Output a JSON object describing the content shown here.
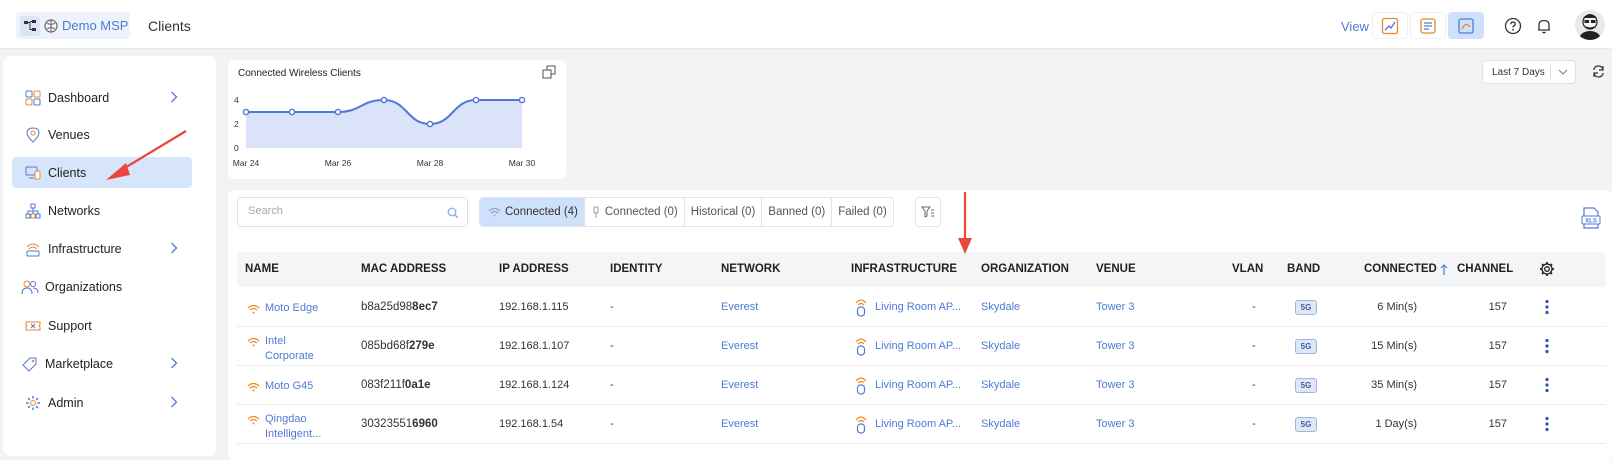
{
  "header": {
    "brand": "Demo MSP",
    "page_title": "Clients",
    "view_label": "View",
    "view_buttons": [
      "dashboard-view-icon",
      "report-view-icon",
      "analytics-view-icon"
    ],
    "active_view": 2
  },
  "sidebar": {
    "items": [
      {
        "label": "Dashboard",
        "icon": "dashboard-icon",
        "chevron": true
      },
      {
        "label": "Venues",
        "icon": "location-pin-icon",
        "chevron": false
      },
      {
        "label": "Clients",
        "icon": "devices-icon",
        "chevron": false,
        "active": true
      },
      {
        "label": "Networks",
        "icon": "network-icon",
        "chevron": false
      },
      {
        "label": "Infrastructure",
        "icon": "access-point-icon",
        "chevron": true
      },
      {
        "label": "Organizations",
        "icon": "users-icon",
        "chevron": false
      },
      {
        "label": "Support",
        "icon": "ticket-icon",
        "chevron": false
      },
      {
        "label": "Marketplace",
        "icon": "tag-icon",
        "chevron": true
      },
      {
        "label": "Admin",
        "icon": "gear-icon",
        "chevron": true
      }
    ]
  },
  "chart_card": {
    "title": "Connected Wireless Clients"
  },
  "chart_data": {
    "type": "area",
    "title": "Connected Wireless Clients",
    "x": [
      "Mar 24",
      "Mar 25",
      "Mar 26",
      "Mar 27",
      "Mar 28",
      "Mar 29",
      "Mar 30"
    ],
    "x_tick_labels": [
      "Mar 24",
      "Mar 26",
      "Mar 28",
      "Mar 30"
    ],
    "values": [
      3,
      3,
      3,
      4,
      2,
      4,
      4
    ],
    "y_ticks": [
      0,
      2,
      4
    ],
    "ylim": [
      0,
      4
    ],
    "grid": false,
    "color": "#4f7ad6",
    "fill": "#dbe3f8"
  },
  "date_range": {
    "value": "Last 7 Days"
  },
  "toolbar": {
    "search_placeholder": "Search",
    "tabs": [
      {
        "label": "Connected (4)",
        "icon": "wifi-icon",
        "active": true
      },
      {
        "label": "Connected (0)",
        "icon": "wired-icon",
        "active": false
      },
      {
        "label": "Historical (0)",
        "icon": "",
        "active": false
      },
      {
        "label": "Banned (0)",
        "icon": "",
        "active": false
      },
      {
        "label": "Failed (0)",
        "icon": "",
        "active": false
      }
    ]
  },
  "table": {
    "columns": [
      "NAME",
      "MAC ADDRESS",
      "IP ADDRESS",
      "IDENTITY",
      "NETWORK",
      "INFRASTRUCTURE",
      "ORGANIZATION",
      "VENUE",
      "VLAN",
      "BAND",
      "CONNECTED",
      "CHANNEL"
    ],
    "rows": [
      {
        "name": [
          "Moto Edge"
        ],
        "mac_prefix": "b8a25d98",
        "mac_suffix": "8ec7",
        "ip": "192.168.1.115",
        "identity": "-",
        "network": "Everest",
        "infrastructure": "Living Room AP...",
        "organization": "Skydale",
        "venue": "Tower 3",
        "vlan": "-",
        "band": "5G",
        "connected": "6 Min(s)",
        "channel": "157"
      },
      {
        "name": [
          "Intel",
          "Corporate"
        ],
        "mac_prefix": "085bd68f",
        "mac_suffix": "279e",
        "ip": "192.168.1.107",
        "identity": "-",
        "network": "Everest",
        "infrastructure": "Living Room AP...",
        "organization": "Skydale",
        "venue": "Tower 3",
        "vlan": "-",
        "band": "5G",
        "connected": "15 Min(s)",
        "channel": "157"
      },
      {
        "name": [
          "Moto G45"
        ],
        "mac_prefix": "083f211f",
        "mac_suffix": "0a1e",
        "ip": "192.168.1.124",
        "identity": "-",
        "network": "Everest",
        "infrastructure": "Living Room AP...",
        "organization": "Skydale",
        "venue": "Tower 3",
        "vlan": "-",
        "band": "5G",
        "connected": "35 Min(s)",
        "channel": "157"
      },
      {
        "name": [
          "Qingdao",
          "Intelligent..."
        ],
        "mac_prefix": "30323551",
        "mac_suffix": "6960",
        "ip": "192.168.1.54",
        "identity": "-",
        "network": "Everest",
        "infrastructure": "Living Room AP...",
        "organization": "Skydale",
        "venue": "Tower 3",
        "vlan": "-",
        "band": "5G",
        "connected": "1 Day(s)",
        "channel": "157"
      }
    ]
  },
  "colors": {
    "accent": "#4f7ad6",
    "active_bg": "#d7e5fb",
    "annotation_arrow": "#e8473b",
    "wifi_orange": "#f08a24"
  }
}
